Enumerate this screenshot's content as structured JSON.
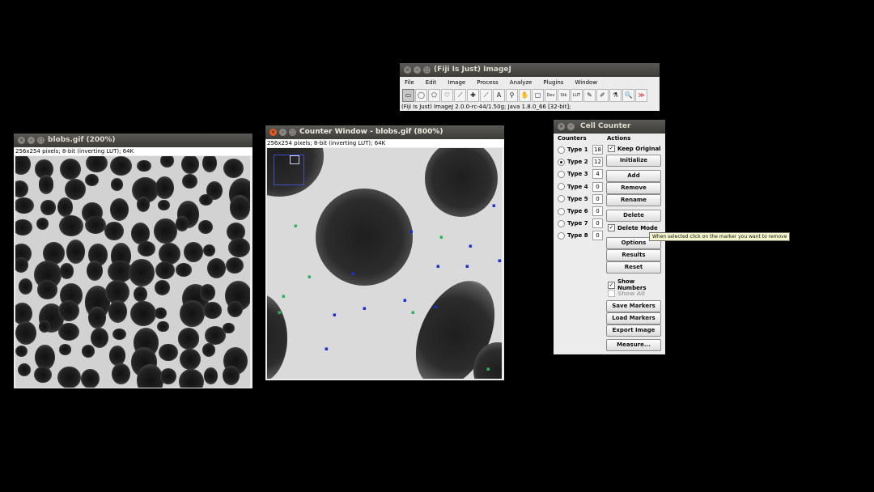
{
  "windows": {
    "blobs_small": {
      "title": "blobs.gif (200%)",
      "info": "256x254 pixels; 8-bit (inverting LUT); 64K"
    },
    "counter_window": {
      "title": "Counter Window - blobs.gif (800%)",
      "info": "256x254 pixels; 8-bit (inverting LUT); 64K"
    },
    "imagej": {
      "title": "(Fiji Is Just) ImageJ",
      "menus": [
        "File",
        "Edit",
        "Image",
        "Process",
        "Analyze",
        "Plugins",
        "Window",
        "Help"
      ],
      "tools": [
        {
          "icon": "rectangle-tool-icon",
          "glyph": "▭"
        },
        {
          "icon": "oval-tool-icon",
          "glyph": "◯"
        },
        {
          "icon": "polygon-tool-icon",
          "glyph": "⬠"
        },
        {
          "icon": "freehand-tool-icon",
          "glyph": "♡"
        },
        {
          "icon": "line-tool-icon",
          "glyph": "⟋"
        },
        {
          "icon": "point-tool-icon",
          "glyph": "✚"
        },
        {
          "icon": "wand-tool-icon",
          "glyph": "⟋"
        },
        {
          "icon": "text-tool-icon",
          "glyph": "A"
        },
        {
          "icon": "magnifier-tool-icon",
          "glyph": "⚲"
        },
        {
          "icon": "hand-tool-icon",
          "glyph": "✋"
        },
        {
          "icon": "color-picker-tool-icon",
          "glyph": "▢"
        },
        {
          "icon": "dev-tool-icon",
          "glyph": "Dev"
        },
        {
          "icon": "stack-tool-icon",
          "glyph": "Stk"
        },
        {
          "icon": "lut-tool-icon",
          "glyph": "LUT"
        },
        {
          "icon": "pencil-tool-icon",
          "glyph": "✎"
        },
        {
          "icon": "brush-tool-icon",
          "glyph": "✐"
        },
        {
          "icon": "dropper-tool-icon",
          "glyph": "⚗"
        },
        {
          "icon": "image-tool-icon",
          "glyph": "🔍"
        },
        {
          "icon": "more-tools-icon",
          "glyph": "≫"
        }
      ],
      "status": "(Fiji Is Just) ImageJ 2.0.0-rc-44/1.50g; Java 1.8.0_66 [32-bit];"
    },
    "cell_counter": {
      "title": "Cell Counter",
      "counters_label": "Counters",
      "actions_label": "Actions",
      "types": [
        {
          "label": "Type 1",
          "count": "18",
          "selected": false
        },
        {
          "label": "Type 2",
          "count": "12",
          "selected": true
        },
        {
          "label": "Type 3",
          "count": "4",
          "selected": false
        },
        {
          "label": "Type 4",
          "count": "0",
          "selected": false
        },
        {
          "label": "Type 5",
          "count": "0",
          "selected": false
        },
        {
          "label": "Type 6",
          "count": "0",
          "selected": false
        },
        {
          "label": "Type 7",
          "count": "0",
          "selected": false
        },
        {
          "label": "Type 8",
          "count": "0",
          "selected": false
        }
      ],
      "keep_original": "Keep Original",
      "initialize": "Initialize",
      "add": "Add",
      "remove": "Remove",
      "rename": "Rename",
      "delete": "Delete",
      "delete_mode": "Delete Mode",
      "options": "Options",
      "results": "Results",
      "reset": "Reset",
      "show_numbers": "Show Numbers",
      "show_all": "Show All",
      "save_markers": "Save Markers",
      "load_markers": "Load Markers",
      "export_image": "Export Image",
      "measure": "Measure...",
      "tooltip": "When selected click on the marker you want to remove"
    }
  }
}
